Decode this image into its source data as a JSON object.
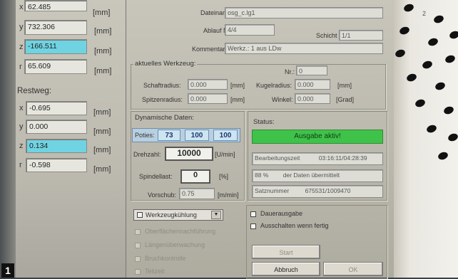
{
  "position": {
    "x": {
      "axis": "x",
      "value": "62.485",
      "unit": "[mm]"
    },
    "y": {
      "axis": "y",
      "value": "732.306",
      "unit": "[mm]"
    },
    "z": {
      "axis": "z",
      "value": "-166.511",
      "unit": "[mm]"
    },
    "r": {
      "axis": "r",
      "value": "65.609",
      "unit": "[mm]"
    }
  },
  "restweg": {
    "title": "Restweg:",
    "x": {
      "axis": "x",
      "value": "-0.695",
      "unit": "[mm]"
    },
    "y": {
      "axis": "y",
      "value": "0.000",
      "unit": "[mm]"
    },
    "z": {
      "axis": "z",
      "value": "0.134",
      "unit": "[mm]"
    },
    "r": {
      "axis": "r",
      "value": "-0.598",
      "unit": "[mm]"
    }
  },
  "file": {
    "dateiname_label": "Dateiname",
    "dateiname_value": "osg_c.lg1",
    "ablauf_label": "Ablauf  Nr.",
    "ablauf_value": "4/4",
    "schicht_label": "Schicht",
    "schicht_value": "1/1",
    "kommentar_label": "Kommentar",
    "kommentar_value": "Werkz.: 1 aus LDw"
  },
  "tool": {
    "title": "aktuelles Werkzeug:",
    "nr_label": "Nr.:",
    "nr_value": "0",
    "schaftradius_label": "Schaftradius:",
    "schaftradius_value": "0.000",
    "schaftradius_unit": "[mm]",
    "spitzenradius_label": "Spitzenradius:",
    "spitzenradius_value": "0.000",
    "spitzenradius_unit": "[mm]",
    "kugelradius_label": "Kugelradius:",
    "kugelradius_value": "0.000",
    "kugelradius_unit": "[mm]",
    "winkel_label": "Winkel:",
    "winkel_value": "0.000",
    "winkel_unit": "[Grad]"
  },
  "dynamic": {
    "title": "Dynamische Daten:",
    "potis_label": "Poties:",
    "potis": [
      "73",
      "100",
      "100"
    ],
    "drehzahl_label": "Drehzahl:",
    "drehzahl_value": "10000",
    "drehzahl_unit": "[U/min]",
    "spindellast_label": "Spindellast:",
    "spindellast_value": "0",
    "spindellast_unit": "[%]",
    "vorschub_label": "Vorschub:",
    "vorschub_value": "0.75",
    "vorschub_unit": "[m/min]"
  },
  "status": {
    "title": "Status:",
    "banner": "Ausgabe aktiv!",
    "banner_color": "#3fc24a",
    "bearbeitungszeit_label": "Bearbeitungszeit",
    "bearbeitungszeit_value": "03:16:11/04:28:39",
    "percent_value": "88 %",
    "percent_text": "der Daten übermittelt",
    "satznummer_label": "Satznummer",
    "satznummer_value": "675531/1009470"
  },
  "options": {
    "werkzeugkuehlung": "Werkzeugkühlung",
    "oberflaechen": "Oberflächennachführung",
    "laengen": "Längenüberwachung",
    "bruch": "Bruchkontrolle",
    "teilzeit": "Teilzeit",
    "dauerausgabe": "Dauerausgabe",
    "ausschalten": "Ausschalten wenn fertig"
  },
  "buttons": {
    "start": "Start",
    "abbruch": "Abbruch",
    "ok": "OK"
  },
  "corner_badge": "1",
  "corner_mark": "2"
}
